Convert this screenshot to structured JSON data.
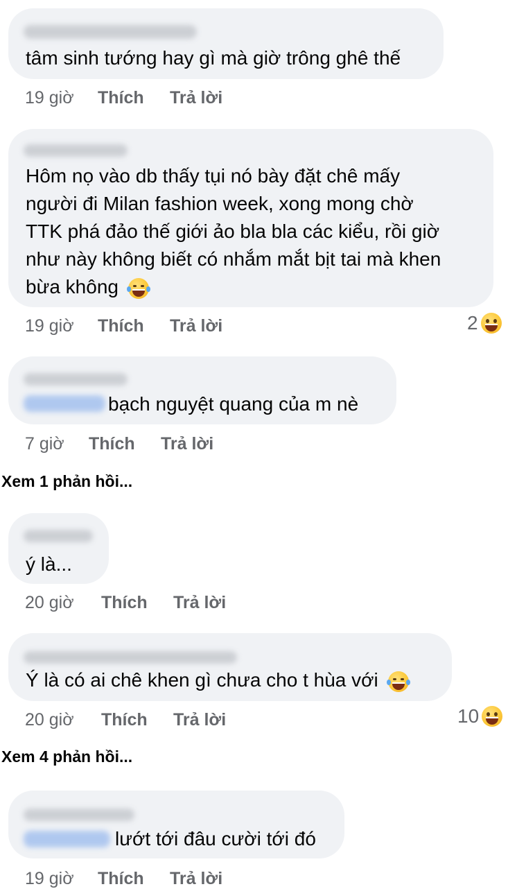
{
  "comments": [
    {
      "text": "tâm sinh tướng hay gì mà giờ trông ghê thế",
      "time": "19 giờ",
      "like": "Thích",
      "reply": "Trả lời"
    },
    {
      "lines": [
        "Hôm nọ vào db thấy tụi nó bày đặt chê mấy",
        "người đi Milan fashion week, xong mong chờ",
        "TTK phá đảo thế giới ảo bla bla các kiểu, rồi giờ",
        "như này không biết có nhắm mắt bịt tai mà khen",
        "bừa không"
      ],
      "time": "19 giờ",
      "like": "Thích",
      "reply": "Trả lời",
      "reaction_count": "2"
    },
    {
      "text": "bạch nguyệt quang của m nè",
      "time": "7 giờ",
      "like": "Thích",
      "reply": "Trả lời"
    },
    {
      "text": "ý là...",
      "time": "20 giờ",
      "like": "Thích",
      "reply": "Trả lời"
    },
    {
      "text": "Ý là có ai chê khen gì chưa cho t hùa với",
      "time": "20 giờ",
      "like": "Thích",
      "reply": "Trả lời",
      "reaction_count": "10"
    },
    {
      "text": "lướt tới đâu cười tới đó",
      "time": "19 giờ",
      "like": "Thích",
      "reply": "Trả lời"
    }
  ],
  "view_more": [
    "Xem 1 phản hồi...",
    "Xem 4 phản hồi..."
  ],
  "icons": {
    "laughing_tears": "face-with-tears-of-joy-icon",
    "haha_reaction": "haha-reaction-icon"
  },
  "colors": {
    "bubble": "#f0f2f5",
    "meta": "#65676b",
    "text": "#050505"
  }
}
